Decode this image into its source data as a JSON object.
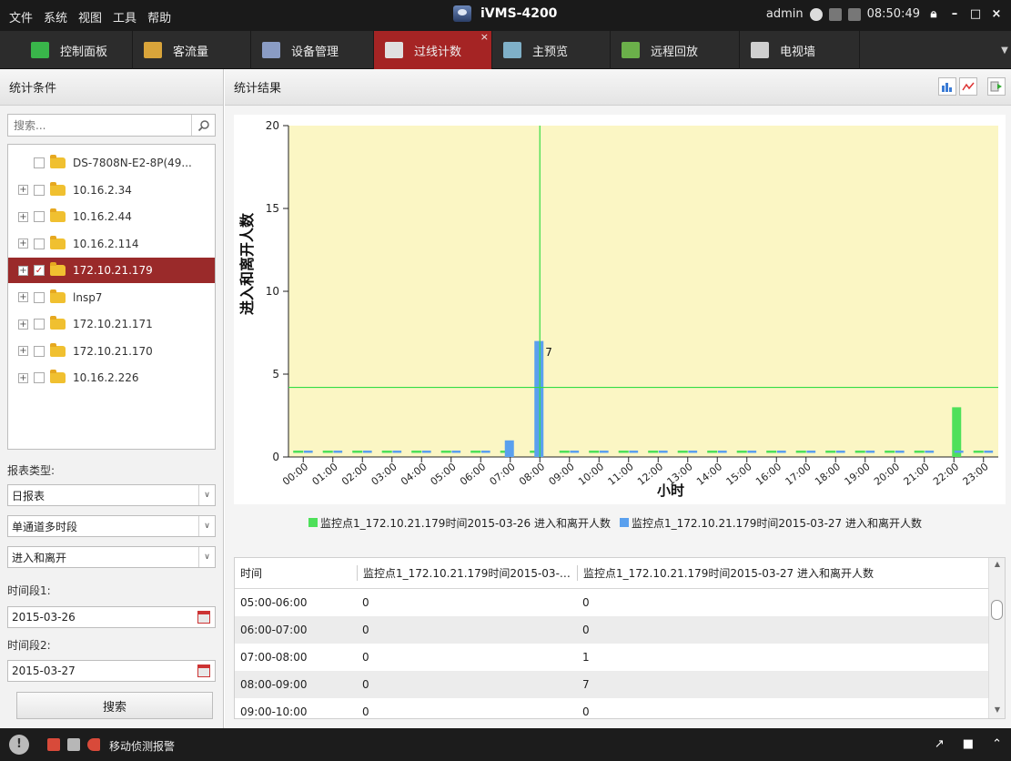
{
  "titlebar": {
    "menu": [
      "文件",
      "系统",
      "视图",
      "工具",
      "帮助"
    ],
    "app_title": "iVMS-4200",
    "user": "admin",
    "clock": "08:50:49",
    "cpu_label": "CPU",
    "ram_label": "RAM"
  },
  "tabs": [
    {
      "label": "控制面板",
      "icon": "control-panel-icon",
      "color": "#39b54a"
    },
    {
      "label": "客流量",
      "icon": "people-flow-icon",
      "color": "#d9a43a"
    },
    {
      "label": "设备管理",
      "icon": "device-management-icon",
      "color": "#8a9cc4"
    },
    {
      "label": "过线计数",
      "icon": "line-crossing-icon",
      "color": "#e0e0e0"
    },
    {
      "label": "主预览",
      "icon": "main-view-icon",
      "color": "#7fb0c8"
    },
    {
      "label": "远程回放",
      "icon": "remote-playback-icon",
      "color": "#6bb04a"
    },
    {
      "label": "电视墙",
      "icon": "video-wall-icon",
      "color": "#cfcfcf"
    }
  ],
  "active_tab": 3,
  "left": {
    "header": "统计条件",
    "search_placeholder": "搜索...",
    "tree": [
      {
        "label": "DS-7808N-E2-8P(49...",
        "expander": false,
        "checked": false,
        "selected": false
      },
      {
        "label": "10.16.2.34",
        "expander": true,
        "checked": false,
        "selected": false
      },
      {
        "label": "10.16.2.44",
        "expander": true,
        "checked": false,
        "selected": false
      },
      {
        "label": "10.16.2.114",
        "expander": true,
        "checked": false,
        "selected": false
      },
      {
        "label": "172.10.21.179",
        "expander": true,
        "checked": true,
        "selected": true
      },
      {
        "label": "lnsp7",
        "expander": true,
        "checked": false,
        "selected": false
      },
      {
        "label": "172.10.21.171",
        "expander": true,
        "checked": false,
        "selected": false
      },
      {
        "label": "172.10.21.170",
        "expander": true,
        "checked": false,
        "selected": false
      },
      {
        "label": "10.16.2.226",
        "expander": true,
        "checked": false,
        "selected": false
      }
    ],
    "report_type_label": "报表类型:",
    "report_type": "日报表",
    "channel_mode": "单通道多时段",
    "direction": "进入和离开",
    "period1_label": "时间段1:",
    "period1": "2015-03-26",
    "period2_label": "时间段2:",
    "period2": "2015-03-27",
    "search_button": "搜索"
  },
  "right": {
    "header": "统计结果"
  },
  "chart_data": {
    "type": "bar",
    "ylabel": "进入和离开人数",
    "xlabel": "小时",
    "ylim": [
      0,
      20
    ],
    "yticks": [
      0,
      5,
      10,
      15,
      20
    ],
    "categories": [
      "00:00",
      "01:00",
      "02:00",
      "03:00",
      "04:00",
      "05:00",
      "06:00",
      "07:00",
      "08:00",
      "09:00",
      "10:00",
      "11:00",
      "12:00",
      "13:00",
      "14:00",
      "15:00",
      "16:00",
      "17:00",
      "18:00",
      "19:00",
      "20:00",
      "21:00",
      "22:00",
      "23:00"
    ],
    "series": [
      {
        "name": "监控点1_172.10.21.179时间2015-03-26 进入和离开人数",
        "color": "#4ee05a",
        "values": [
          0,
          0,
          0,
          0,
          0,
          0,
          0,
          0,
          0,
          0,
          0,
          0,
          0,
          0,
          0,
          0,
          0,
          0,
          0,
          0,
          0,
          0,
          3,
          0
        ]
      },
      {
        "name": "监控点1_172.10.21.179时间2015-03-27 进入和离开人数",
        "color": "#5aa0ee",
        "values": [
          0,
          0,
          0,
          0,
          0,
          0,
          0,
          1,
          7,
          0,
          0,
          0,
          0,
          0,
          0,
          0,
          0,
          0,
          0,
          0,
          0,
          0,
          0,
          0
        ]
      }
    ],
    "data_labels": [
      {
        "x": "08:00",
        "text": "7"
      }
    ],
    "crosshair": {
      "x": "08:00",
      "y": 4.2
    },
    "plot_background": "#fbf6c4",
    "grid": false,
    "legend_position": "bottom"
  },
  "table": {
    "headers": [
      "时间",
      "监控点1_172.10.21.179时间2015-03-26 进入和离开人数",
      "监控点1_172.10.21.179时间2015-03-27 进入和离开人数"
    ],
    "rows": [
      [
        "05:00-06:00",
        "0",
        "0"
      ],
      [
        "06:00-07:00",
        "0",
        "0"
      ],
      [
        "07:00-08:00",
        "0",
        "1"
      ],
      [
        "08:00-09:00",
        "0",
        "7"
      ],
      [
        "09:00-10:00",
        "0",
        "0"
      ]
    ]
  },
  "statusbar": {
    "alarm_text": "移动侦测报警"
  },
  "colors": {
    "active_tab": "#a52424",
    "selected_tree_row": "#9a2a2a"
  }
}
